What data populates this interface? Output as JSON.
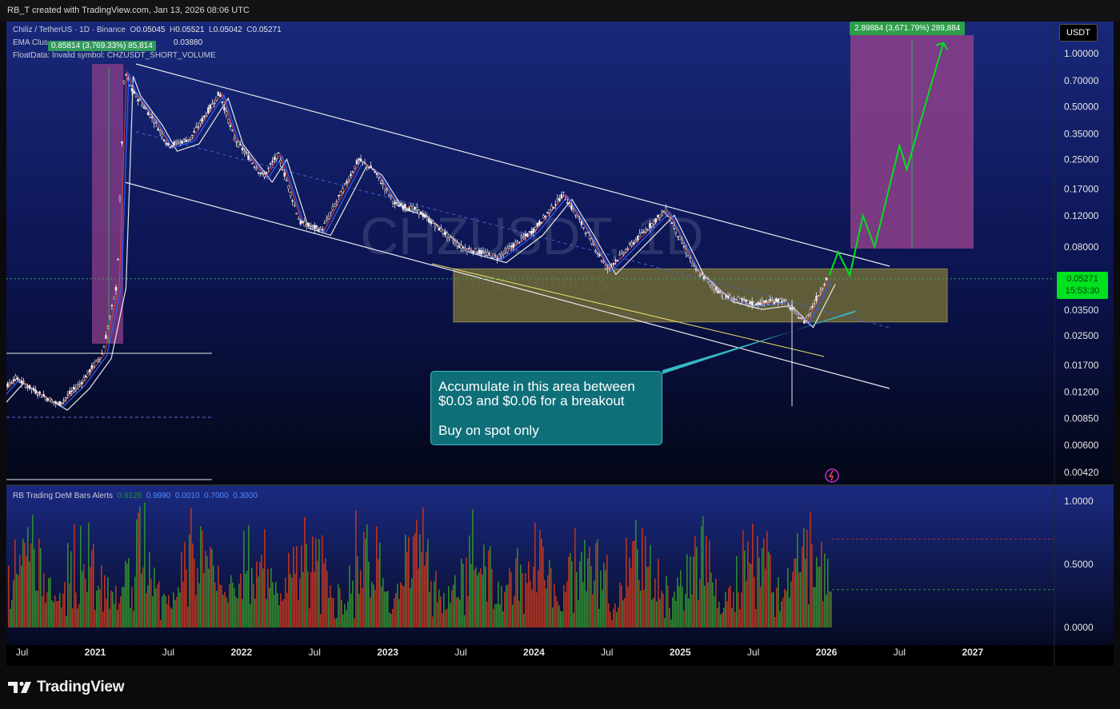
{
  "header": {
    "credit": "RB_T created with TradingView.com, Jan 13, 2026 08:06 UTC"
  },
  "legend": {
    "symbol_line": "Chiliz / TetherUS · 1D · Binance",
    "o_label": "O",
    "o_value": "0.05045",
    "h_label": "H",
    "h_value": "0.05521",
    "l_label": "L",
    "l_value": "0.05042",
    "c_label": "C",
    "c_value": "0.05271",
    "ema_line": "EMA Clus",
    "ema_value": "0.03880",
    "float_line": "FloatData: Invalid symbol: CHZUSDT_SHORT_VOLUME"
  },
  "measure_badge_left": "0.85814 (3,769.33%) 85,814",
  "measure_badge_right": "2.89884 (3,671.79%) 289,884",
  "watermark": {
    "symbol": "CHZUSDT, 1D",
    "name": "Chiliz / TetherUS"
  },
  "callout": {
    "line1": "Accumulate in this area between",
    "line2": "$0.03 and $0.06 for a breakout",
    "line3": "Buy on spot only"
  },
  "currency_button": "USDT",
  "last_price": {
    "value": "0.05271",
    "countdown": "15:53:30"
  },
  "indicator": {
    "name": "RB Trading DeM Bars Alerts",
    "v1": "0.9128",
    "v2": "0.9990",
    "v3": "0.0010",
    "v4": "0.7000",
    "v5": "0.3000",
    "y_ticks": [
      "1.0000",
      "0.5000",
      "0.0000"
    ]
  },
  "brand": "TradingView",
  "colors": {
    "up_line": "#00e11f",
    "zone_fill": "#6f6a37",
    "target_box": "#8e3f8a",
    "callout_bg": "#0f6f79",
    "ema_fast": "#e0413a",
    "ema_mid": "#2a62ff",
    "ema_slow": "#e6e6e6"
  },
  "chart_data": {
    "type": "line",
    "title": "CHZUSDT, 1D",
    "subtitle": "Chiliz / TetherUS",
    "scale": "log",
    "y_ticks": [
      "1.00000",
      "0.70000",
      "0.50000",
      "0.35000",
      "0.25000",
      "0.17000",
      "0.12000",
      "0.08000",
      "0.03500",
      "0.02500",
      "0.01700",
      "0.01200",
      "0.00850",
      "0.00600",
      "0.00420"
    ],
    "x_ticks": [
      "Jul",
      "2021",
      "Jul",
      "2022",
      "Jul",
      "2023",
      "Jul",
      "2024",
      "Jul",
      "2025",
      "Jul",
      "2026",
      "Jul",
      "2027"
    ],
    "price_path": [
      {
        "t": 2020.25,
        "p": 0.0095
      },
      {
        "t": 2020.45,
        "p": 0.0145
      },
      {
        "t": 2020.6,
        "p": 0.012
      },
      {
        "t": 2020.75,
        "p": 0.0102
      },
      {
        "t": 2020.9,
        "p": 0.0135
      },
      {
        "t": 2021.05,
        "p": 0.02
      },
      {
        "t": 2021.15,
        "p": 0.05
      },
      {
        "t": 2021.2,
        "p": 0.8
      },
      {
        "t": 2021.25,
        "p": 0.62
      },
      {
        "t": 2021.4,
        "p": 0.42
      },
      {
        "t": 2021.5,
        "p": 0.3
      },
      {
        "t": 2021.65,
        "p": 0.33
      },
      {
        "t": 2021.85,
        "p": 0.6
      },
      {
        "t": 2021.95,
        "p": 0.33
      },
      {
        "t": 2022.15,
        "p": 0.2
      },
      {
        "t": 2022.25,
        "p": 0.27
      },
      {
        "t": 2022.4,
        "p": 0.11
      },
      {
        "t": 2022.55,
        "p": 0.1
      },
      {
        "t": 2022.8,
        "p": 0.25
      },
      {
        "t": 2022.9,
        "p": 0.22
      },
      {
        "t": 2023.05,
        "p": 0.14
      },
      {
        "t": 2023.2,
        "p": 0.13
      },
      {
        "t": 2023.5,
        "p": 0.08
      },
      {
        "t": 2023.75,
        "p": 0.07
      },
      {
        "t": 2024.0,
        "p": 0.1
      },
      {
        "t": 2024.2,
        "p": 0.16
      },
      {
        "t": 2024.35,
        "p": 0.1
      },
      {
        "t": 2024.5,
        "p": 0.06
      },
      {
        "t": 2024.65,
        "p": 0.08
      },
      {
        "t": 2024.9,
        "p": 0.13
      },
      {
        "t": 2025.1,
        "p": 0.06
      },
      {
        "t": 2025.3,
        "p": 0.042
      },
      {
        "t": 2025.5,
        "p": 0.038
      },
      {
        "t": 2025.7,
        "p": 0.04
      },
      {
        "t": 2025.85,
        "p": 0.03
      },
      {
        "t": 2026.0,
        "p": 0.0527
      }
    ],
    "projection": [
      {
        "t": 2026.02,
        "p": 0.055
      },
      {
        "t": 2026.08,
        "p": 0.075
      },
      {
        "t": 2026.16,
        "p": 0.055
      },
      {
        "t": 2026.25,
        "p": 0.12
      },
      {
        "t": 2026.33,
        "p": 0.08
      },
      {
        "t": 2026.5,
        "p": 0.3
      },
      {
        "t": 2026.55,
        "p": 0.22
      },
      {
        "t": 2026.7,
        "p": 0.6
      },
      {
        "t": 2026.8,
        "p": 1.15
      }
    ],
    "accumulation_zone": {
      "from_t": 2023.45,
      "to_t": 2026.8,
      "low": 0.03,
      "high": 0.06
    },
    "last_price": 0.05271
  }
}
